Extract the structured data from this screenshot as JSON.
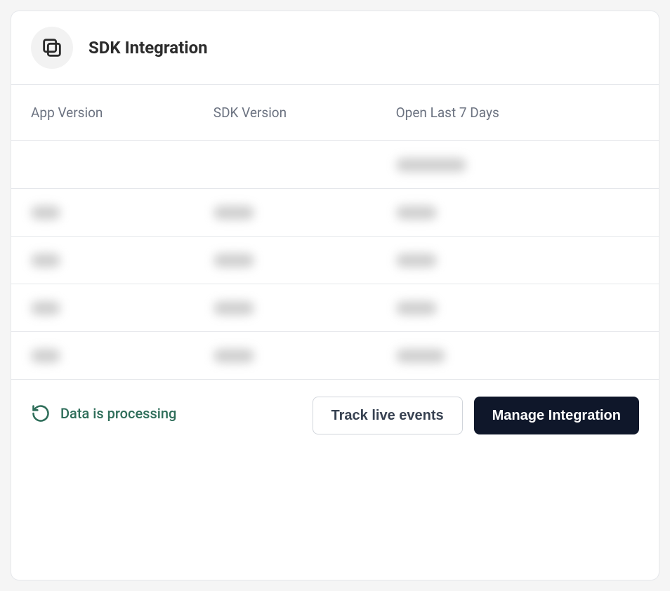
{
  "header": {
    "title": "SDK Integration"
  },
  "table": {
    "columns": {
      "app_version": "App Version",
      "sdk_version": "SDK Version",
      "open_last_7_days": "Open Last 7 Days"
    }
  },
  "footer": {
    "status": "Data is processing",
    "track_button": "Track live events",
    "manage_button": "Manage Integration"
  }
}
